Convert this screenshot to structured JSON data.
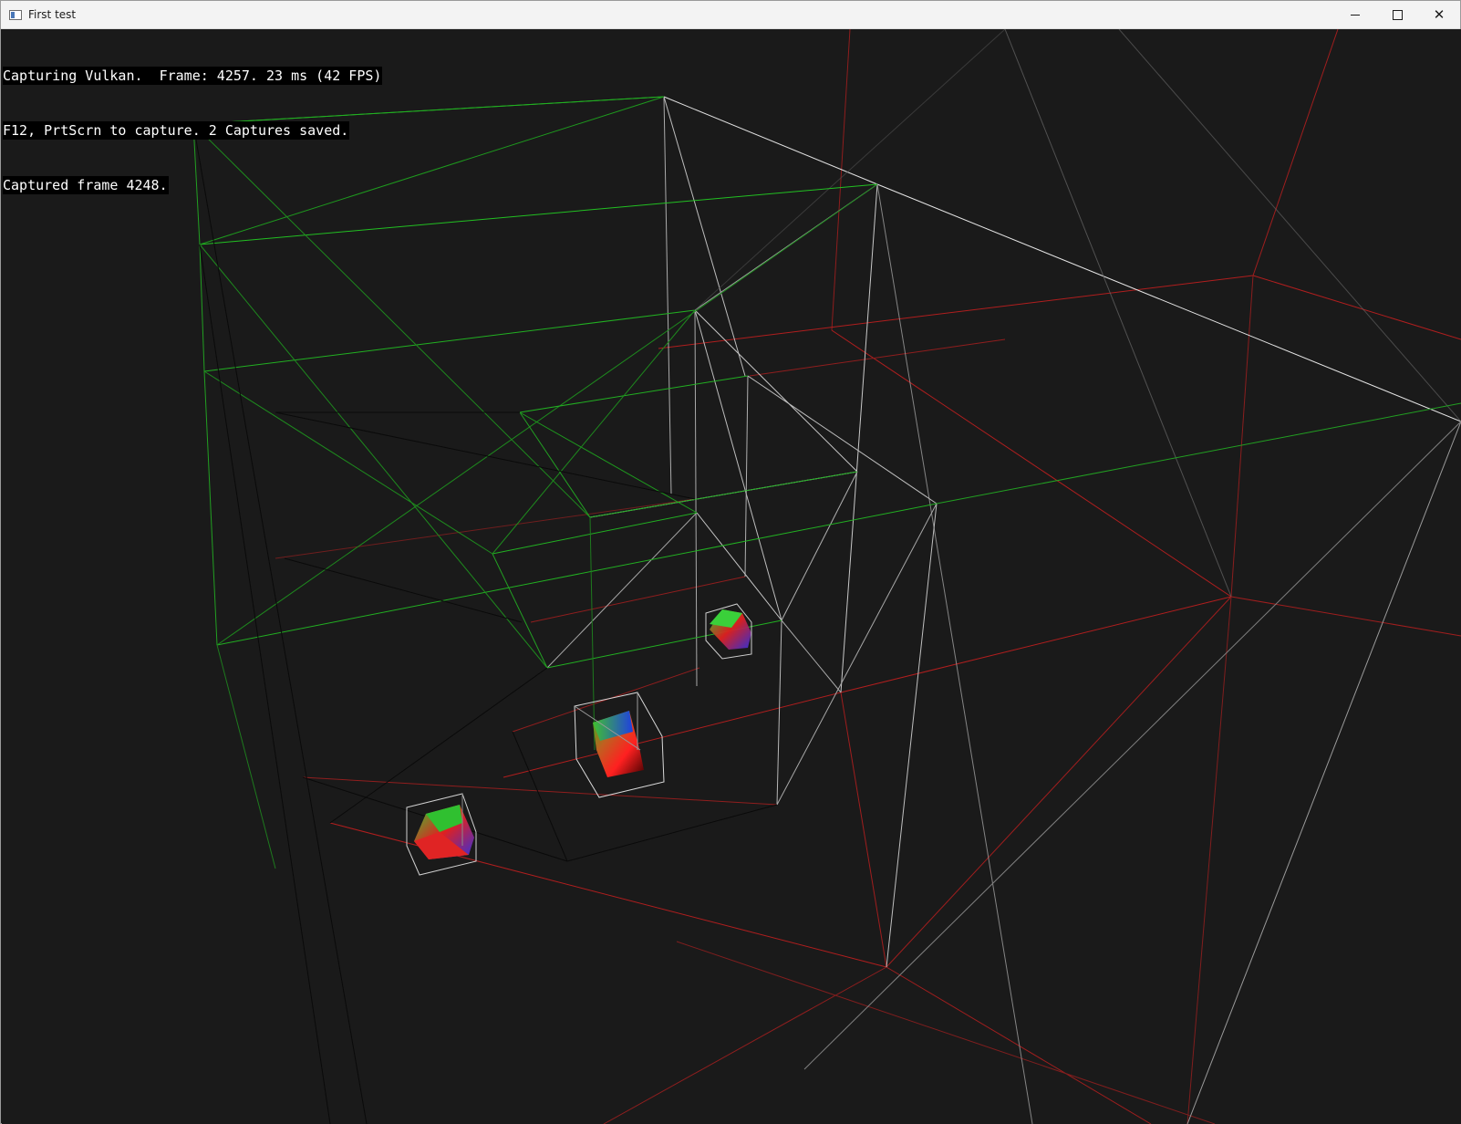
{
  "window": {
    "title": "First test",
    "minimize_label": "Minimize",
    "maximize_label": "Maximize",
    "close_label": "Close"
  },
  "overlay": {
    "line1": "Capturing Vulkan.  Frame: 4257. 23 ms (42 FPS)",
    "line2": "F12, PrtScrn to capture. 2 Captures saved.",
    "line3": "Captured frame 4248."
  },
  "colors": {
    "background": "#1a1a1a",
    "green_lines": "#22c022",
    "white_lines": "#e0e0e0",
    "red_lines": "#c81e1e"
  }
}
